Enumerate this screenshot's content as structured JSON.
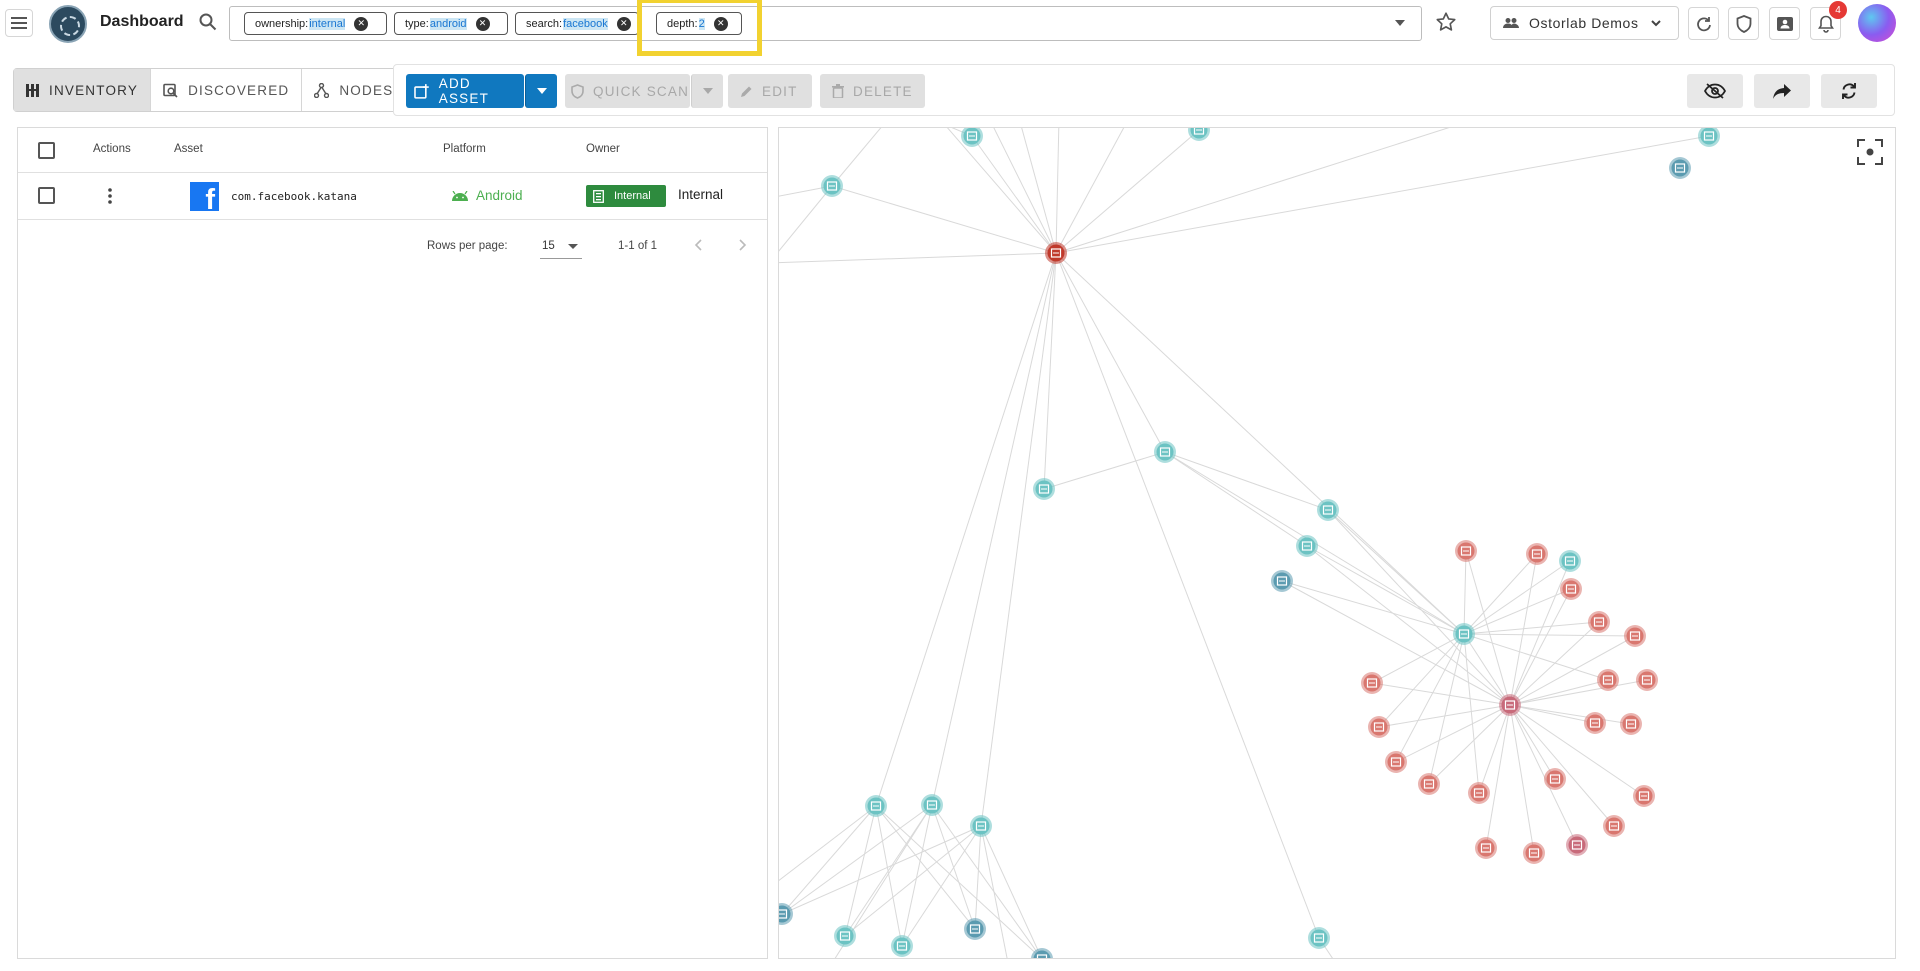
{
  "header": {
    "title": "Dashboard",
    "filters": [
      {
        "key": "ownership:",
        "value": "internal"
      },
      {
        "key": "type:",
        "value": "android"
      },
      {
        "key": "search:",
        "value": "facebook"
      },
      {
        "key": "depth:",
        "value": "2"
      }
    ],
    "organization": "Ostorlab Demos",
    "notifications_count": "4"
  },
  "tabs": [
    {
      "label": "INVENTORY",
      "icon": "inventory-icon",
      "active": true
    },
    {
      "label": "DISCOVERED",
      "icon": "discovered-icon",
      "active": false
    },
    {
      "label": "NODES",
      "icon": "nodes-icon",
      "active": false
    }
  ],
  "toolbar": {
    "add_asset": "ADD ASSET",
    "quick_scan": "QUICK SCAN",
    "edit": "EDIT",
    "delete": "DELETE"
  },
  "table": {
    "columns": [
      "Actions",
      "Asset",
      "Platform",
      "Owner"
    ],
    "rows": [
      {
        "asset": "com.facebook.katana",
        "platform": "Android",
        "owner_tag": "Internal",
        "owner": "Internal"
      }
    ],
    "rows_per_page_label": "Rows per page:",
    "rows_per_page": "15",
    "range": "1-1 of 1"
  },
  "colors": {
    "primary": "#1078bf",
    "android_green": "#4caf50",
    "internal_tag": "#2e8b3e",
    "node_teal": "#6cc3c3",
    "node_blue": "#5b9bb0",
    "node_red": "#d9776f",
    "node_dark_red": "#c0392b",
    "node_purple": "#c86a7a",
    "highlight": "#f2d230"
  }
}
